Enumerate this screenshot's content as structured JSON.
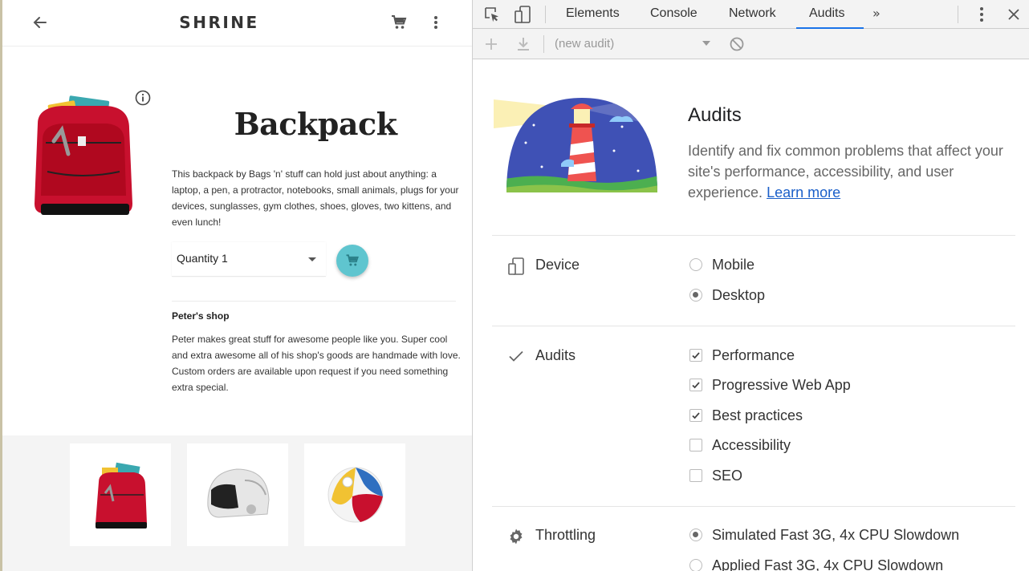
{
  "shrine": {
    "brand": "SHRINE",
    "product_title": "Backpack",
    "description": "This backpack by Bags 'n' stuff can hold just about anything: a laptop, a pen, a protractor, notebooks, small animals, plugs for your devices, sunglasses, gym clothes, shoes, gloves, two kittens, and even lunch!",
    "quantity_label": "Quantity 1",
    "shop_title": "Peter's shop",
    "shop_description": "Peter makes great stuff for awesome people like you. Super cool and extra awesome all of his shop's goods are handmade with love. Custom orders are available upon request if you need something extra special."
  },
  "devtools": {
    "tabs": [
      "Elements",
      "Console",
      "Network",
      "Audits"
    ],
    "active_tab": "Audits",
    "audit_select_value": "(new audit)",
    "panel_title": "Audits",
    "panel_description": "Identify and fix common problems that affect your site's performance, accessibility, and user experience.",
    "learn_more": "Learn more",
    "sections": {
      "device": {
        "label": "Device",
        "options": [
          {
            "label": "Mobile",
            "selected": false
          },
          {
            "label": "Desktop",
            "selected": true
          }
        ]
      },
      "audits": {
        "label": "Audits",
        "options": [
          {
            "label": "Performance",
            "checked": true
          },
          {
            "label": "Progressive Web App",
            "checked": true
          },
          {
            "label": "Best practices",
            "checked": true
          },
          {
            "label": "Accessibility",
            "checked": false
          },
          {
            "label": "SEO",
            "checked": false
          }
        ]
      },
      "throttling": {
        "label": "Throttling",
        "options": [
          {
            "label": "Simulated Fast 3G, 4x CPU Slowdown",
            "selected": true
          },
          {
            "label": "Applied Fast 3G, 4x CPU Slowdown",
            "selected": false
          }
        ]
      }
    }
  },
  "colors": {
    "accent": "#1a73e8",
    "fab": "#5fc5cf",
    "link": "#1a5fc9"
  }
}
